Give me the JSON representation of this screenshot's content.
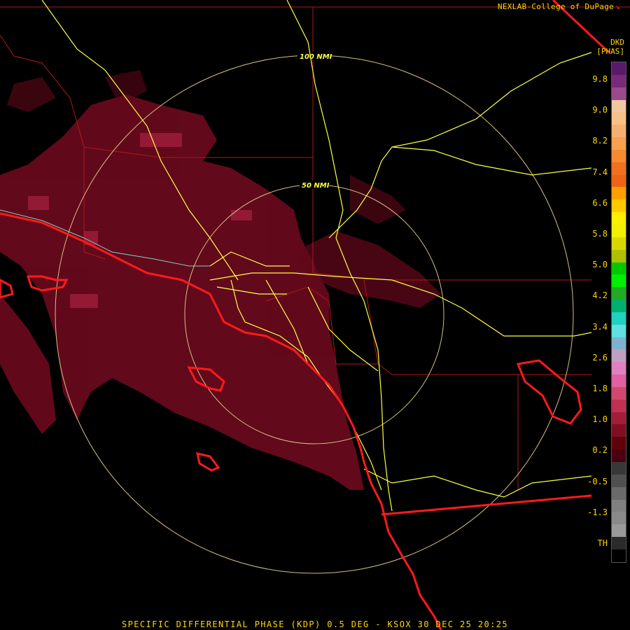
{
  "credit": "NEXLAB-College of DuPage",
  "credit_icon": "arrow-icon",
  "product": {
    "code": "DKD",
    "units": "[PHAS]"
  },
  "range_rings": [
    "50 NMI",
    "100 NMI"
  ],
  "caption": "SPECIFIC DIFFERENTIAL PHASE (KDP) 0.5 DEG - KSOX 30 DEC 25 20:25",
  "legend": {
    "ticks": [
      "9.8",
      "9.0",
      "8.2",
      "7.4",
      "6.6",
      "5.8",
      "5.0",
      "4.2",
      "3.4",
      "2.6",
      "1.8",
      "1.0",
      "0.2",
      "-0.5",
      "-1.3",
      "TH"
    ],
    "colors": [
      "#5a1a6a",
      "#7a2a7a",
      "#9a4a8a",
      "#f0c8a0",
      "#f7c08a",
      "#f5b070",
      "#f7a050",
      "#f58a30",
      "#f07020",
      "#ee6414",
      "#ffa000",
      "#ffc800",
      "#ffee00",
      "#f0f000",
      "#d8d800",
      "#b0c000",
      "#00c800",
      "#00ee00",
      "#22aa22",
      "#00b070",
      "#20d0c0",
      "#60e0e0",
      "#80b0d0",
      "#c0a0c0",
      "#e080c0",
      "#e060a0",
      "#d04870",
      "#c03050",
      "#a01e38",
      "#800e20",
      "#600008",
      "#4a0010",
      "#383838",
      "#505050",
      "#6a6a6a",
      "#808080",
      "#8a8a8a",
      "#999999",
      "#2a2a2a",
      "#000000"
    ]
  },
  "colors": {
    "echo": "#6a0a1e",
    "echo_bright": "#a01e3c",
    "coast": "#ff1a1a",
    "roads": "#ffff44",
    "boundaries": "#b01818",
    "rings": "#d8c080"
  }
}
